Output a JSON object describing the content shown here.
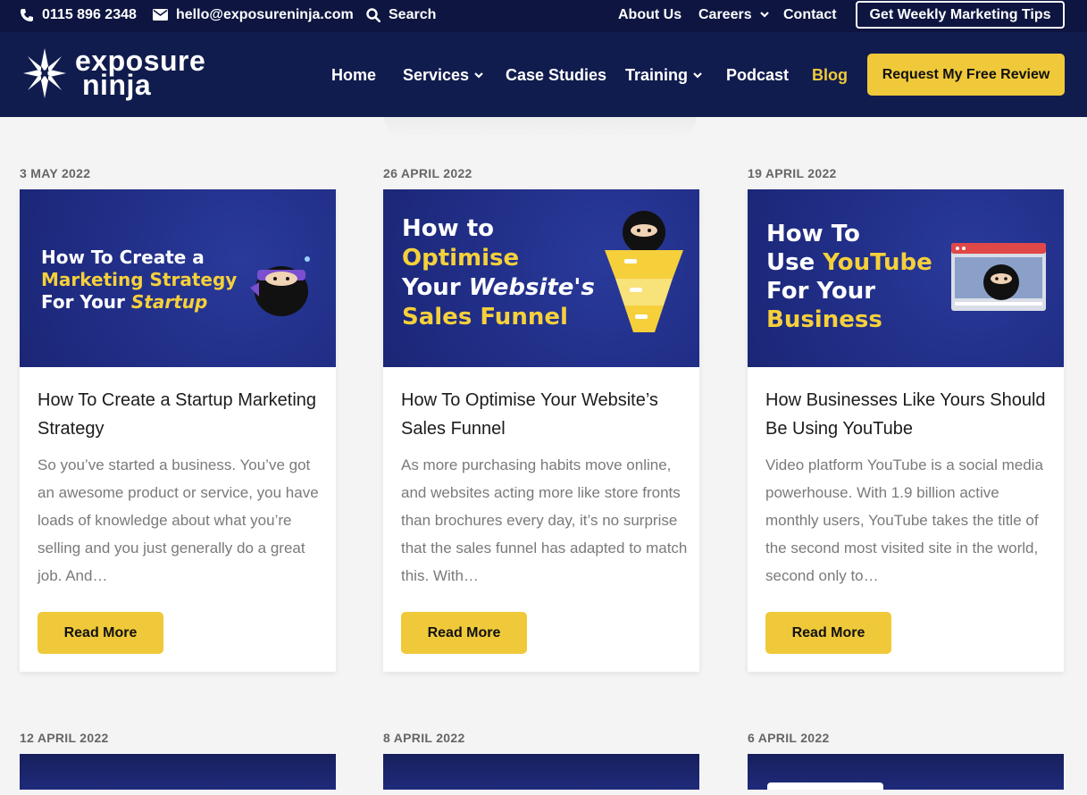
{
  "topbar": {
    "phone": "0115 896 2348",
    "email": "hello@exposureninja.com",
    "search": "Search",
    "links": [
      "About Us",
      "Careers",
      "Contact"
    ],
    "tips_button": "Get Weekly Marketing Tips"
  },
  "brand": {
    "line1": "exposure",
    "line2": "ninja"
  },
  "nav": {
    "items": [
      "Home",
      "Services",
      "Case Studies",
      "Training",
      "Podcast",
      "Blog"
    ],
    "cta": "Request My Free Review"
  },
  "colors": {
    "navy": "#111c4e",
    "topbar": "#0d1540",
    "accent": "#f0c93a"
  },
  "posts": [
    {
      "date": "3 MAY 2022",
      "thumb": {
        "l1": "How To Create a",
        "l2": "Marketing Strategy",
        "l3a": "For Your ",
        "l3b": "Startup"
      },
      "title": "How To Create a Startup Marketing Strategy",
      "excerpt": "So you’ve started a business. You’ve got an awesome product or service, you have loads of knowledge about what you’re selling and you just generally do a great job. And…",
      "button": "Read More"
    },
    {
      "date": "26 APRIL 2022",
      "thumb": {
        "l1": "How to",
        "l2": "Optimise",
        "l3a": "Your ",
        "l3b": "Website's",
        "l4": "Sales Funnel"
      },
      "title": "How To Optimise Your Website’s Sales Funnel",
      "excerpt": "As more purchasing habits move online, and websites acting more like store fronts than brochures every day, it’s no surprise that the sales funnel has adapted to match this. With…",
      "button": "Read More"
    },
    {
      "date": "19 APRIL 2022",
      "thumb": {
        "l1": "How To",
        "l2a": "Use ",
        "l2b": "YouTube",
        "l3": "For Your",
        "l4": "Business"
      },
      "title": "How Businesses Like Yours Should Be Using YouTube",
      "excerpt": "Video platform YouTube is a social media powerhouse. With 1.9 billion active monthly users, YouTube takes the title of the second most visited site in the world, second only to…",
      "button": "Read More"
    }
  ],
  "next_posts": [
    {
      "date": "12 APRIL 2022"
    },
    {
      "date": "8 APRIL 2022"
    },
    {
      "date": "6 APRIL 2022"
    }
  ]
}
